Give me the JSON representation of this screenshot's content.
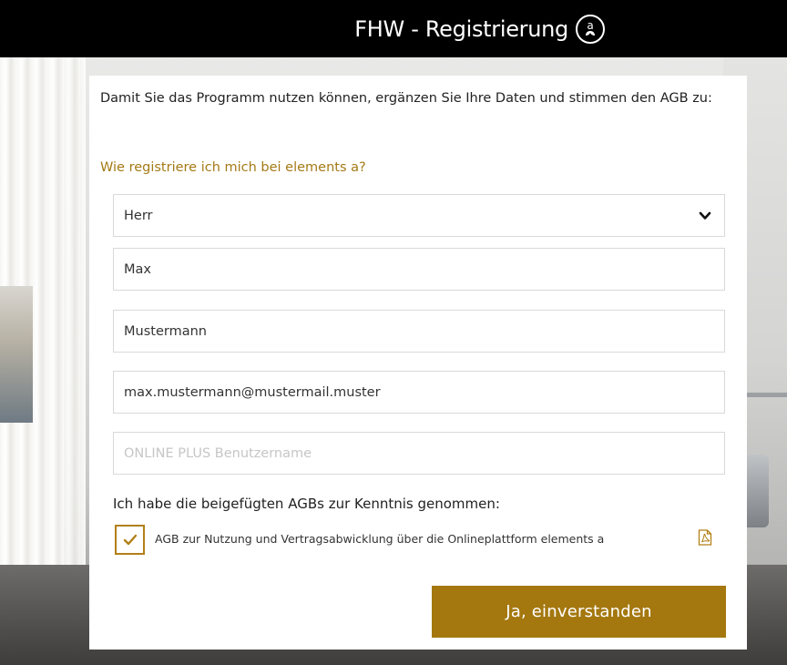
{
  "header": {
    "title": "FHW - Registrierung",
    "logo_icon": "elements-a-logo-icon"
  },
  "form": {
    "intro": "Damit Sie das Programm nutzen können, ergänzen Sie Ihre Daten und stimmen den AGB zu:",
    "help_link": "Wie registriere ich mich bei elements a?",
    "salutation": {
      "value": "Herr",
      "icon": "chevron-down-icon"
    },
    "first_name": "Max",
    "last_name": "Mustermann",
    "email": "max.mustermann@mustermail.muster",
    "username_placeholder": "ONLINE PLUS Benutzername",
    "agb_heading": "Ich habe die beigefügten AGBs zur Kenntnis genommen:",
    "agb_checkbox_label": "AGB zur Nutzung und Vertragsabwicklung über die Onlineplattform elements a",
    "agb_checked": true,
    "pdf_icon": "pdf-file-icon",
    "submit_label": "Ja, einverstanden"
  },
  "colors": {
    "accent": "#a4780f",
    "link": "#a57a16",
    "header_bg": "#000000"
  }
}
